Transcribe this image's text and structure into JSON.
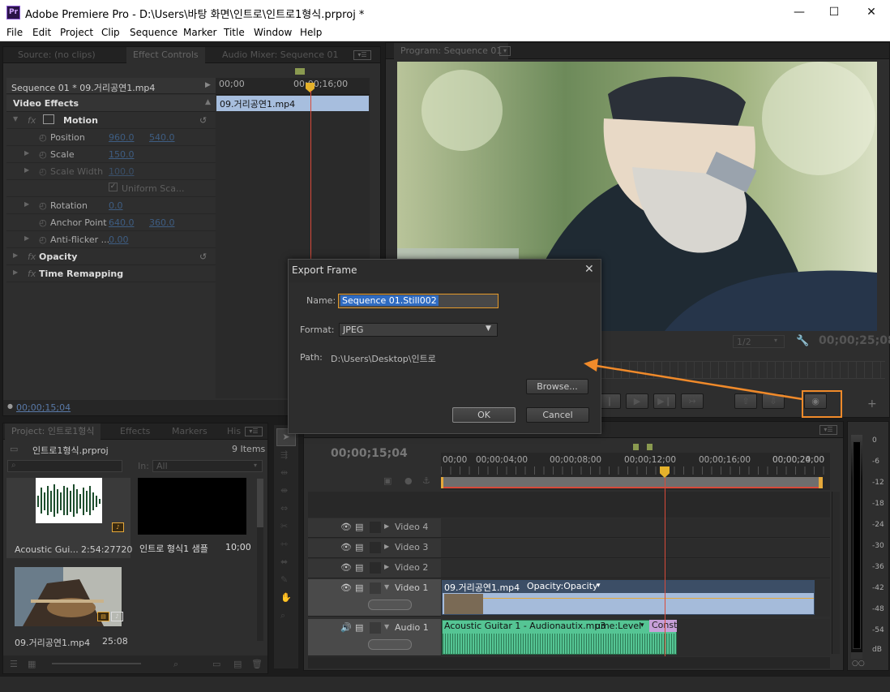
{
  "window": {
    "app_icon": "Pr",
    "title": "Adobe Premiere Pro - D:\\Users\\바탕 화면\\인트로\\인트로1형식.prproj *",
    "minimize": "—",
    "maximize": "☐",
    "close": "✕"
  },
  "menu": [
    "File",
    "Edit",
    "Project",
    "Clip",
    "Sequence",
    "Marker",
    "Title",
    "Window",
    "Help"
  ],
  "source_panel": {
    "tabs": [
      "Source: (no clips)",
      "Effect Controls",
      "Audio Mixer: Sequence 01"
    ],
    "sequence_label": "Sequence 01 * 09.거리공연1.mp4",
    "ruler_start": "00;00",
    "ruler_mid": "00;00;16;00",
    "clip_label": "09.거리공연1.mp4",
    "section_title": "Video Effects",
    "motion": "Motion",
    "rows": [
      {
        "label": "Position",
        "v1": "960.0",
        "v2": "540.0"
      },
      {
        "label": "Scale",
        "v1": "150.0",
        "v2": ""
      },
      {
        "label": "Scale Width",
        "v1": "100.0",
        "v2": ""
      },
      {
        "label": "Uniform Sca...",
        "v1": "",
        "v2": ""
      },
      {
        "label": "Rotation",
        "v1": "0.0",
        "v2": ""
      },
      {
        "label": "Anchor Point",
        "v1": "640.0",
        "v2": "360.0"
      },
      {
        "label": "Anti-flicker ...",
        "v1": "0.00",
        "v2": ""
      }
    ],
    "opacity": "Opacity",
    "time_remapping": "Time Remapping",
    "timecode": "00;00;15;04"
  },
  "program": {
    "tab": "Program: Sequence 01",
    "zoom": "1/2",
    "timecode": "00;00;25;08"
  },
  "dialog": {
    "title": "Export Frame",
    "name_label": "Name:",
    "name_value": "Sequence 01.Still002",
    "format_label": "Format:",
    "format_value": "JPEG",
    "path_label": "Path:",
    "path_value": "D:\\Users\\Desktop\\인트로",
    "browse": "Browse...",
    "ok": "OK",
    "cancel": "Cancel"
  },
  "project": {
    "tabs": [
      "Project: 인트로1형식",
      "Effects",
      "Markers",
      "His"
    ],
    "project_name": "인트로1형식.prproj",
    "item_count": "9 Items",
    "in_label": "In:",
    "in_value": "All",
    "items": [
      {
        "name": "Acoustic Gui...",
        "duration": "2:54:27720"
      },
      {
        "name": "인트로 형식1 샘플",
        "duration": "10;00"
      },
      {
        "name": "09.거리공연1.mp4",
        "duration": "25:08"
      }
    ]
  },
  "timeline": {
    "timecode": "00;00;15;04",
    "ticks": [
      "00;00",
      "00;00;04;00",
      "00;00;08;00",
      "00;00;12;00",
      "00;00;16;00",
      "00;00;20;00",
      "00;00;24;00"
    ],
    "tracks": [
      "Video 4",
      "Video 3",
      "Video 2",
      "Video 1",
      "Audio 1"
    ],
    "video_clip": "09.거리공연1.mp4",
    "video_clip_fx": "Opacity:Opacity",
    "audio_clip": "Acoustic Guitar 1 - Audionautix.mp3",
    "audio_clip_fx": "ume:Level",
    "audio_clip_const": "Const"
  },
  "meter": {
    "labels": [
      "0",
      "-6",
      "-12",
      "-18",
      "-24",
      "-30",
      "-36",
      "-42",
      "-48",
      "-54",
      "dB"
    ]
  }
}
